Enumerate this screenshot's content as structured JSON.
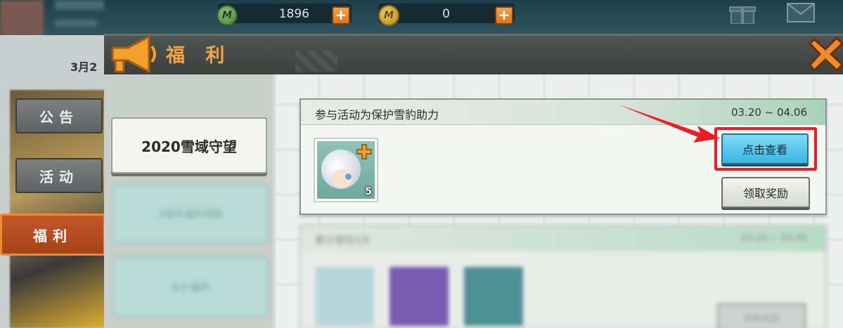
{
  "topbar": {
    "currency_green": {
      "value": "1896",
      "coin_letter": "M",
      "icon": "mini-coin-icon",
      "color": "#3e7a3a"
    },
    "currency_gold": {
      "value": "0",
      "coin_letter": "M",
      "icon": "mini-bean-icon",
      "color": "#b08620"
    },
    "plus_label": "+",
    "gift_icon": "gift-icon",
    "mail_icon": "mail-icon"
  },
  "background": {
    "date_fragment": "3月2"
  },
  "sidebar": {
    "tabs": [
      {
        "label": "公告",
        "active": false
      },
      {
        "label": "活动",
        "active": false
      },
      {
        "label": "福利",
        "active": true
      }
    ]
  },
  "panel": {
    "title": "福 利",
    "header_icon": "megaphone-icon",
    "close_icon": "close-icon",
    "accent_color": "#f4a545"
  },
  "categories": {
    "selected": "2020雪域守望",
    "blurred": [
      "3周年福利领取",
      "女仆福利"
    ]
  },
  "event_card": {
    "title": "参与活动为保护雪豹助力",
    "date_range": "03.20 ~ 04.06",
    "reward_count": "5",
    "view_button": "点击查看",
    "claim_button": "领取奖励",
    "highlight_color": "#ee1c24"
  },
  "event_card_2": {
    "title": "累计登陆3天",
    "date_range": "03.20 ~ 04.06",
    "button": "领取奖励"
  }
}
